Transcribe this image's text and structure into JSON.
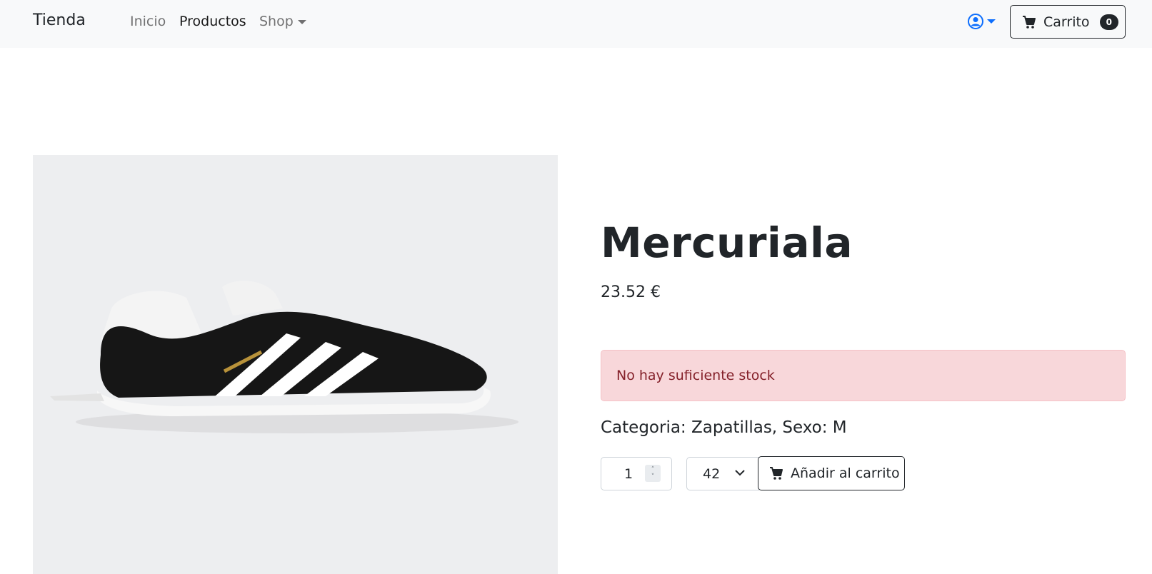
{
  "navbar": {
    "brand": "Tienda",
    "links": [
      {
        "label": "Inicio",
        "active": false
      },
      {
        "label": "Productos",
        "active": true
      },
      {
        "label": "Shop",
        "active": false,
        "dropdown": true
      }
    ],
    "user_icon": "user-circle-icon",
    "cart": {
      "label": "Carrito",
      "count": "0",
      "icon": "cart-icon"
    }
  },
  "product": {
    "name": "Mercuriala",
    "price": "23.52 €",
    "alert": "No hay suficiente stock",
    "meta": "Categoria: Zapatillas, Sexo: M",
    "quantity": "1",
    "size": "42",
    "add_label": "Añadir al carrito",
    "image": "sneaker-photo"
  },
  "colors": {
    "navbar_bg": "#f8f9fa",
    "accent": "#0d6efd",
    "alert_bg": "#f8d7da",
    "alert_text": "#842029"
  }
}
